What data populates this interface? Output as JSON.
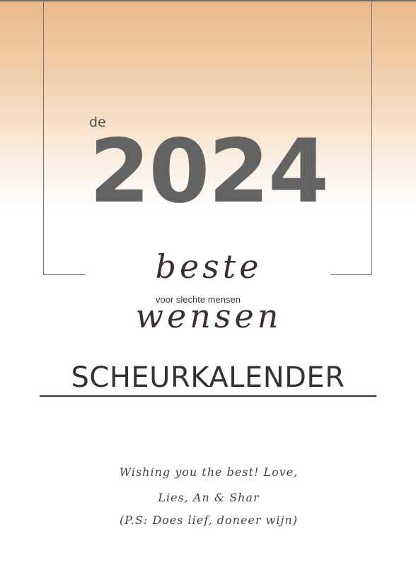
{
  "cover": {
    "prefix": "de",
    "year": "2024",
    "script_title": "beste wensen",
    "subtitle": "voor slechte mensen",
    "main_title": "SCHEURKALENDER"
  },
  "message": {
    "line1": "Wishing you the best! Love,",
    "line2": "Lies, An & Shar",
    "line3": "(P.S: Does lief, doneer wijn)"
  },
  "colors": {
    "gradient_top": "#e9b98a",
    "frame_line": "#7a6c66",
    "year_gray": "#636363",
    "text_dark": "#333333"
  }
}
